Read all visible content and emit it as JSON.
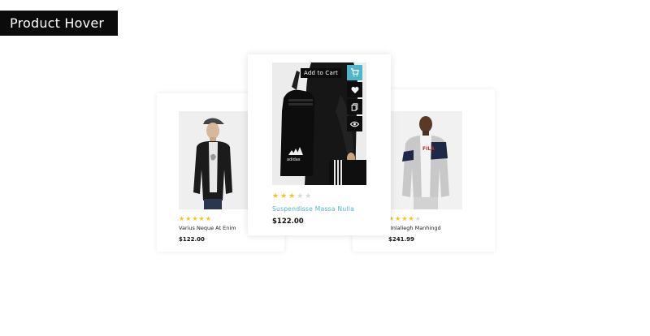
{
  "header": {
    "label": "Product Hover"
  },
  "products": [
    {
      "name": "Varius Neque At Enim",
      "price": "$122.00",
      "rating": 5
    },
    {
      "name": "Suspendisse Massa Nulla",
      "price": "$122.00",
      "rating": 3
    },
    {
      "name": "Unlaliegh Manhingd",
      "price": "$241.99",
      "rating": 4
    }
  ],
  "hover": {
    "tooltip": "Add to Cart",
    "actions": [
      "cart-icon",
      "heart-icon",
      "compare-icon",
      "eye-icon"
    ]
  },
  "colors": {
    "accent": "#4bb7c8",
    "star": "#f5c40f",
    "dark": "#0d0d0d"
  }
}
